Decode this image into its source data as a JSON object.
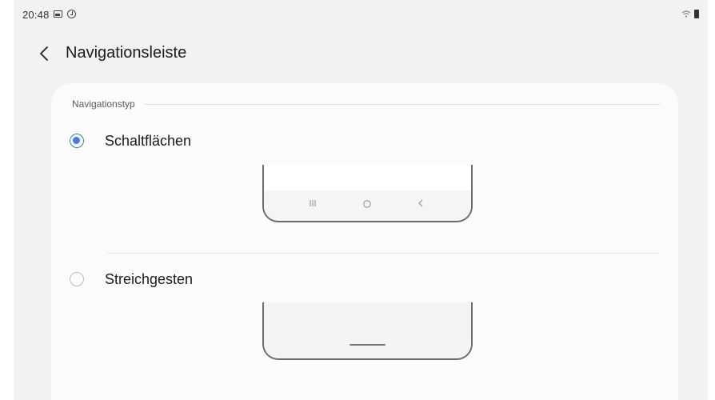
{
  "status_bar": {
    "time": "20:48",
    "icons": [
      "image-icon",
      "sync-icon",
      "wifi-icon",
      "battery-icon"
    ]
  },
  "header": {
    "title": "Navigationsleiste",
    "back_icon": "chevron-left-icon"
  },
  "section": {
    "label": "Navigationstyp"
  },
  "options": [
    {
      "label": "Schaltflächen",
      "selected": true,
      "preview_icons": [
        "recent-apps-icon",
        "home-icon",
        "back-icon"
      ]
    },
    {
      "label": "Streichgesten",
      "selected": false,
      "preview_icons": [
        "gesture-bar-icon"
      ]
    }
  ],
  "colors": {
    "accent": "#3e7ee0",
    "background": "#f2f2f2",
    "card": "#fcfcfc"
  }
}
